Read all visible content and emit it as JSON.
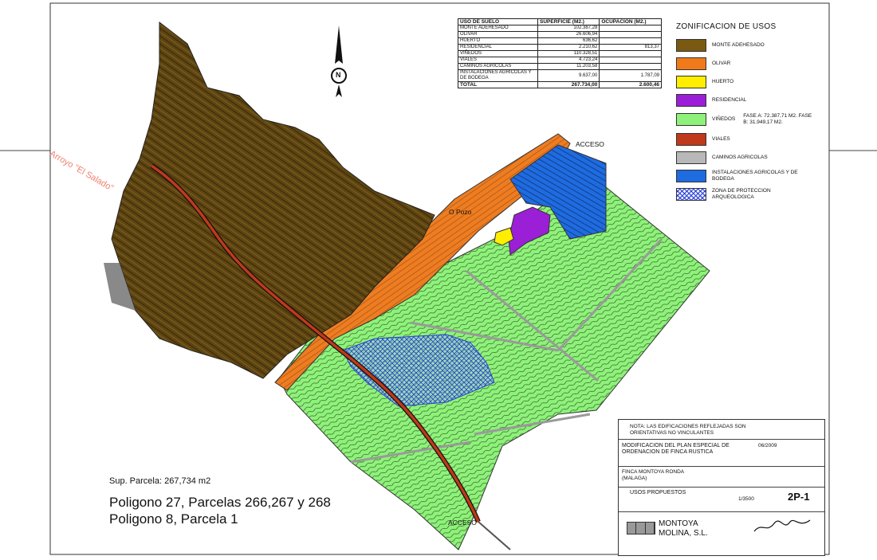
{
  "usage_table": {
    "headers": [
      "USO DE SUELO",
      "SUPERFICIE (M2.)",
      "OCUPACION (M2.)"
    ],
    "rows": [
      {
        "use": "MONTE ADEHESADO",
        "area": "102.387,28",
        "occ": ""
      },
      {
        "use": "OLIVAR",
        "area": "26.606,94",
        "occ": ""
      },
      {
        "use": "HUERTO",
        "area": "636,62",
        "occ": ""
      },
      {
        "use": "RESIDENCIAL",
        "area": "2.210,62",
        "occ": "813,37"
      },
      {
        "use": "VIÑEDOS",
        "area": "110.328,51",
        "occ": ""
      },
      {
        "use": "VIALES",
        "area": "4.723,24",
        "occ": ""
      },
      {
        "use": "CAMINOS AGRICOLAS",
        "area": "11.203,58",
        "occ": ""
      },
      {
        "use": "INSTALACIONES AGRICOLAS Y DE BODEGA",
        "area": "9.637,00",
        "occ": "1.787,09"
      }
    ],
    "total": {
      "label": "TOTAL",
      "area": "267.734,00",
      "occ": "2.600,46"
    }
  },
  "legend": {
    "title": "ZONIFICACION DE USOS",
    "items": [
      {
        "name": "legend-monte-adehesado",
        "label": "MONTE ADEHESADO",
        "color": "#7a5a12",
        "extra": ""
      },
      {
        "name": "legend-olivar",
        "label": "OLIVAR",
        "color": "#f07a1a",
        "extra": ""
      },
      {
        "name": "legend-huerto",
        "label": "HUERTO",
        "color": "#ffee00",
        "extra": ""
      },
      {
        "name": "legend-residencial",
        "label": "RESIDENCIAL",
        "color": "#9b1fd6",
        "extra": ""
      },
      {
        "name": "legend-vinedos",
        "label": "VIÑEDOS",
        "color": "#8ef27a",
        "extra": "FASE A: 72.387,71 M2. FASE B: 31.949,17 M2."
      },
      {
        "name": "legend-viales",
        "label": "VIALES",
        "color": "#c0391b",
        "extra": ""
      },
      {
        "name": "legend-caminos",
        "label": "CAMINOS AGRICOLAS",
        "color": "#b8b8b8",
        "extra": ""
      },
      {
        "name": "legend-instalaciones",
        "label": "INSTALACIONES AGRICOLAS Y DE BODEGA",
        "color": "#1f6be0",
        "extra": ""
      },
      {
        "name": "legend-proteccion",
        "label": "ZONA DE PROTECCION ARQUEOLOGICA",
        "color": "#2b3fd6",
        "extra": "",
        "hatched": true
      }
    ]
  },
  "map": {
    "north_label": "N",
    "stream_label": "Arroyo \"El Salado\"",
    "pozo_label": "O Pozo",
    "access_top": "ACCESO",
    "access_bottom": "ACCESO"
  },
  "parcel": {
    "area": "Sup. Parcela: 267,734 m2",
    "line1": "Poligono 27, Parcelas 266,267 y 268",
    "line2": "Poligono 8, Parcela 1"
  },
  "title_block": {
    "note": "NOTA: LAS EDIFICACIONES REFLEJADAS SON ORIENTATIVAS NO VINCULANTES",
    "project": "MODIFICACION DEL PLAN ESPECIAL DE ORDENACION DE FINCA RUSTICA",
    "date": "06/2009",
    "location": "FINCA MONTOYA RONDA (MALAGA)",
    "plan_name": "USOS PROPUESTOS",
    "scale": "1/3500",
    "sheet_code": "2P-1",
    "company_line1": "MONTOYA",
    "company_line2": "MOLINA, S.L."
  }
}
